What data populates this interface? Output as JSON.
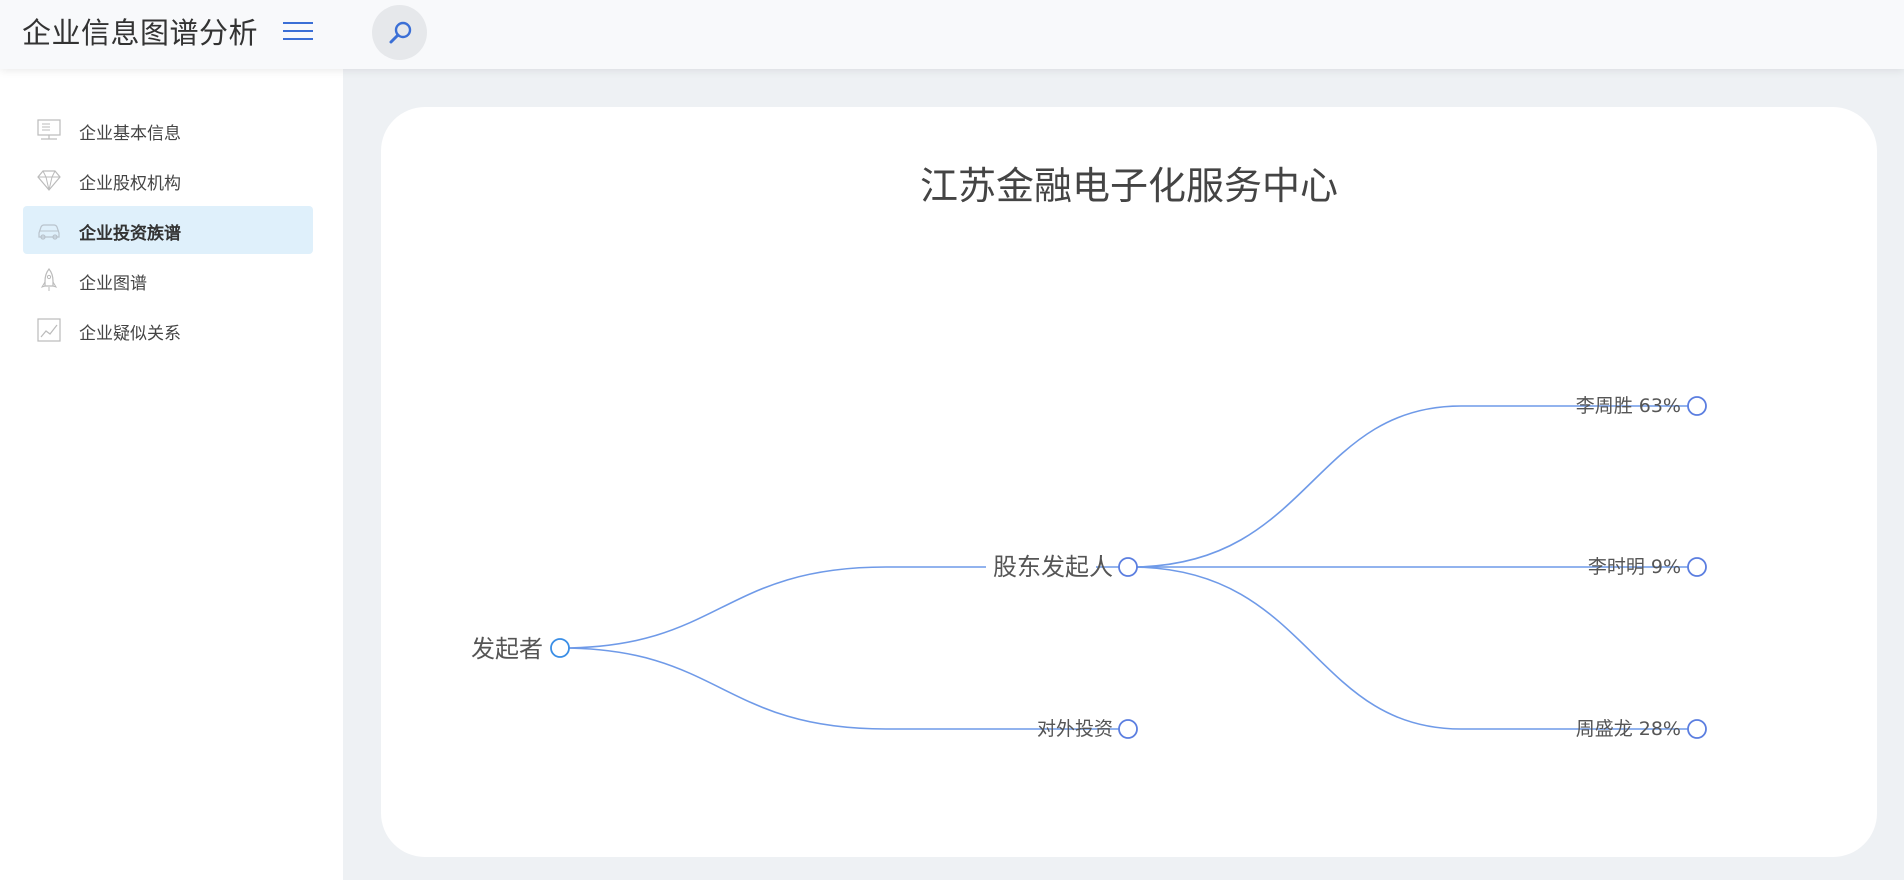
{
  "header": {
    "app_title": "企业信息图谱分析",
    "menu_icon": "hamburger-menu-icon",
    "search_icon": "search-icon"
  },
  "sidebar": {
    "items": [
      {
        "label": "企业基本信息",
        "icon": "monitor-icon",
        "active": false
      },
      {
        "label": "企业股权机构",
        "icon": "diamond-icon",
        "active": false
      },
      {
        "label": "企业投资族谱",
        "icon": "car-icon",
        "active": true
      },
      {
        "label": "企业图谱",
        "icon": "rocket-icon",
        "active": false
      },
      {
        "label": "企业疑似关系",
        "icon": "line-chart-icon",
        "active": false
      }
    ]
  },
  "main": {
    "company_name": "江苏金融电子化服务中心",
    "tree": {
      "root": {
        "label": "发起者"
      },
      "branches": [
        {
          "label": "股东发起人",
          "children": [
            {
              "label": "李周胜 63%"
            },
            {
              "label": "李时明 9%"
            },
            {
              "label": "周盛龙 28%"
            }
          ]
        },
        {
          "label": "对外投资",
          "children": []
        }
      ]
    }
  },
  "colors": {
    "accent": "#3b6fd6",
    "link": "#6f9ae8",
    "active_bg": "#dff0fb",
    "root_node": "#3a8ee6"
  }
}
